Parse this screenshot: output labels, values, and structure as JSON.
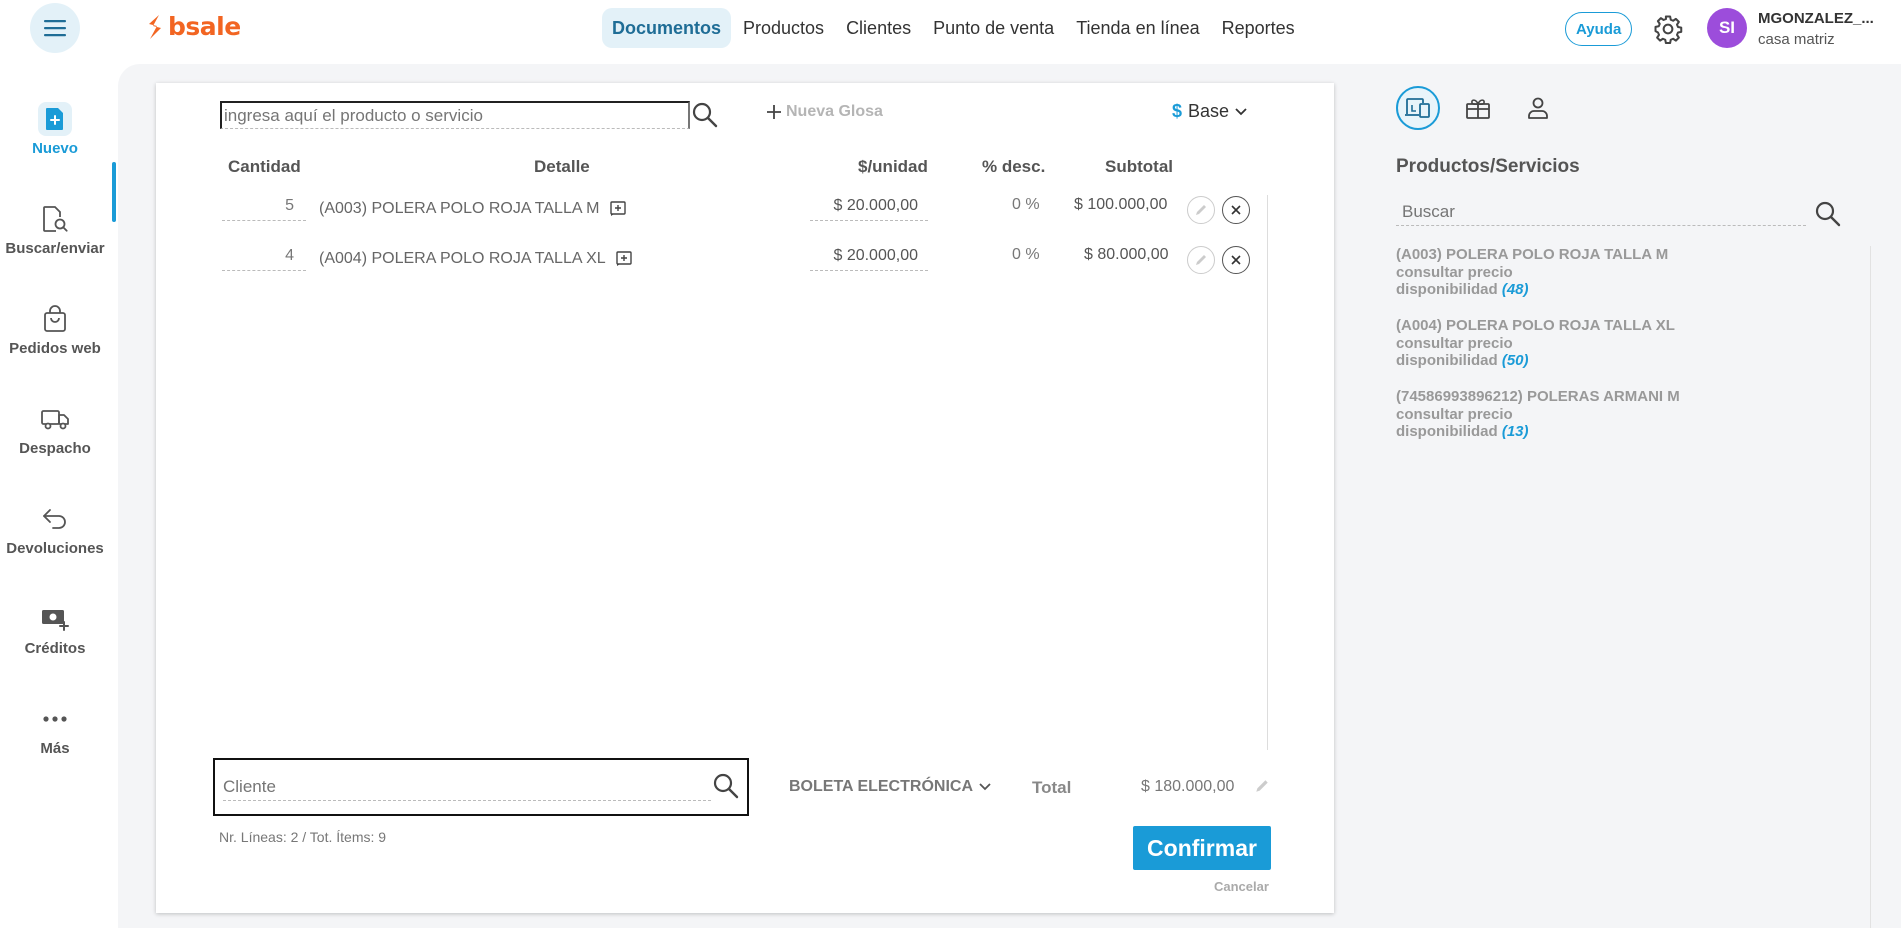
{
  "brand": {
    "name": "bsale",
    "color": "#f26522"
  },
  "accent_color": "#1a9bd7",
  "topnav": [
    "Documentos",
    "Productos",
    "Clientes",
    "Punto de venta",
    "Tienda en línea",
    "Reportes"
  ],
  "topnav_active": "Documentos",
  "help_label": "Ayuda",
  "user": {
    "initials": "SI",
    "name": "MGONZALEZ_...",
    "branch": "casa matriz"
  },
  "sidebar": {
    "active": "Nuevo",
    "items": [
      {
        "label": "Nuevo",
        "icon": "new-document-icon"
      },
      {
        "label": "Buscar/enviar",
        "icon": "document-search-icon"
      },
      {
        "label": "Pedidos web",
        "icon": "shopping-bag-icon"
      },
      {
        "label": "Despacho",
        "icon": "truck-icon"
      },
      {
        "label": "Devoluciones",
        "icon": "return-arrow-icon"
      },
      {
        "label": "Créditos",
        "icon": "money-add-icon"
      },
      {
        "label": "Más",
        "icon": "more-dots-icon"
      }
    ]
  },
  "document": {
    "product_search_placeholder": "ingresa aquí el producto o servicio",
    "nueva_glosa": "Nueva Glosa",
    "currency_symbol": "$",
    "price_list": "Base",
    "columns": {
      "cantidad": "Cantidad",
      "detalle": "Detalle",
      "unit_price": "$/unidad",
      "discount": "% desc.",
      "subtotal": "Subtotal"
    },
    "lines": [
      {
        "qty": "5",
        "detail": "(A003) POLERA POLO ROJA TALLA M",
        "unit_price": "$ 20.000,00",
        "discount": "0 %",
        "subtotal": "$ 100.000,00"
      },
      {
        "qty": "4",
        "detail": "(A004) POLERA POLO ROJA TALLA XL",
        "unit_price": "$ 20.000,00",
        "discount": "0 %",
        "subtotal": "$ 80.000,00"
      }
    ],
    "client_placeholder": "Cliente",
    "doc_type": "BOLETA ELECTRÓNICA",
    "total_label": "Total",
    "total_value": "$ 180.000,00",
    "summary": "Nr. Líneas: 2 / Tot. Ítems: 9",
    "confirm_label": "Confirmar",
    "cancel_label": "Cancelar"
  },
  "right_panel": {
    "tabs": [
      "products-icon",
      "gift-icon",
      "person-icon"
    ],
    "title": "Productos/Servicios",
    "search_placeholder": "Buscar",
    "availability_label": "disponibilidad",
    "items": [
      {
        "name": "(A003) POLERA POLO ROJA TALLA M",
        "price": "consultar precio",
        "availability": "(48)"
      },
      {
        "name": "(A004) POLERA POLO ROJA TALLA XL",
        "price": "consultar precio",
        "availability": "(50)"
      },
      {
        "name": "(74586993896212) POLERAS ARMANI M",
        "price": "consultar precio",
        "availability": "(13)"
      }
    ]
  }
}
